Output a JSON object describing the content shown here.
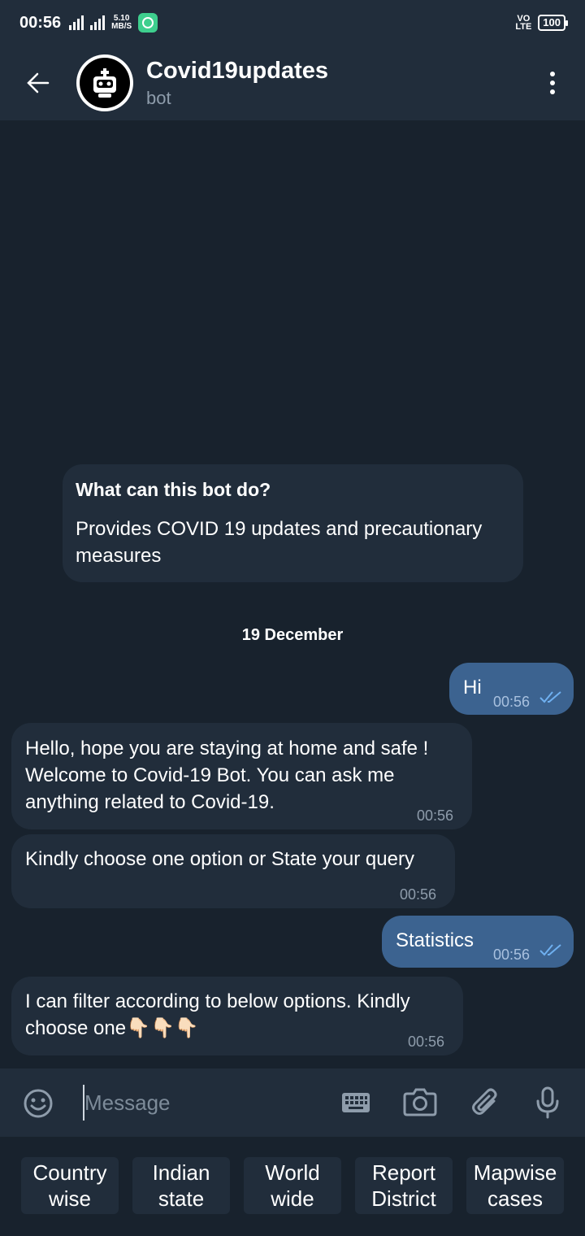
{
  "status_bar": {
    "time": "00:56",
    "network": "4G",
    "speed_value": "5.10",
    "speed_unit": "MB/S",
    "volte_top": "VO",
    "volte_bottom": "LTE",
    "battery": "100"
  },
  "header": {
    "title": "Covid19updates",
    "subtitle": "bot",
    "back_icon": "arrow-left-icon",
    "menu_icon": "more-vertical-icon"
  },
  "bot_info": {
    "title": "What can this bot do?",
    "description": "Provides COVID 19 updates and precautionary measures"
  },
  "date_separator": "19 December",
  "messages": [
    {
      "direction": "out",
      "text": "Hi",
      "time": "00:56",
      "read": true
    },
    {
      "direction": "in",
      "text": "Hello, hope you are staying at home and safe ! Welcome to Covid-19 Bot. You can ask me anything related to Covid-19.",
      "time": "00:56"
    },
    {
      "direction": "in",
      "text": "Kindly choose one option or State your query",
      "time": "00:56"
    },
    {
      "direction": "out",
      "text": "Statistics",
      "time": "00:56",
      "read": true
    },
    {
      "direction": "in",
      "text": "I can filter according to below options. Kindly choose one👇🏻👇🏻👇🏻",
      "time": "00:56"
    }
  ],
  "input": {
    "placeholder": "Message",
    "icons": [
      "emoji-icon",
      "keyboard-icon",
      "camera-icon",
      "attach-icon",
      "microphone-icon"
    ]
  },
  "keyboard_buttons": [
    {
      "line1": "Country",
      "line2": "wise"
    },
    {
      "line1": "Indian",
      "line2": "state"
    },
    {
      "line1": "World",
      "line2": "wide"
    },
    {
      "line1": "Report",
      "line2": "District"
    },
    {
      "line1": "Mapwise",
      "line2": "cases"
    }
  ],
  "colors": {
    "background": "#18222d",
    "surface": "#212d3b",
    "outgoing_bubble": "#3c6390",
    "read_ticks": "#6fb0f0"
  }
}
